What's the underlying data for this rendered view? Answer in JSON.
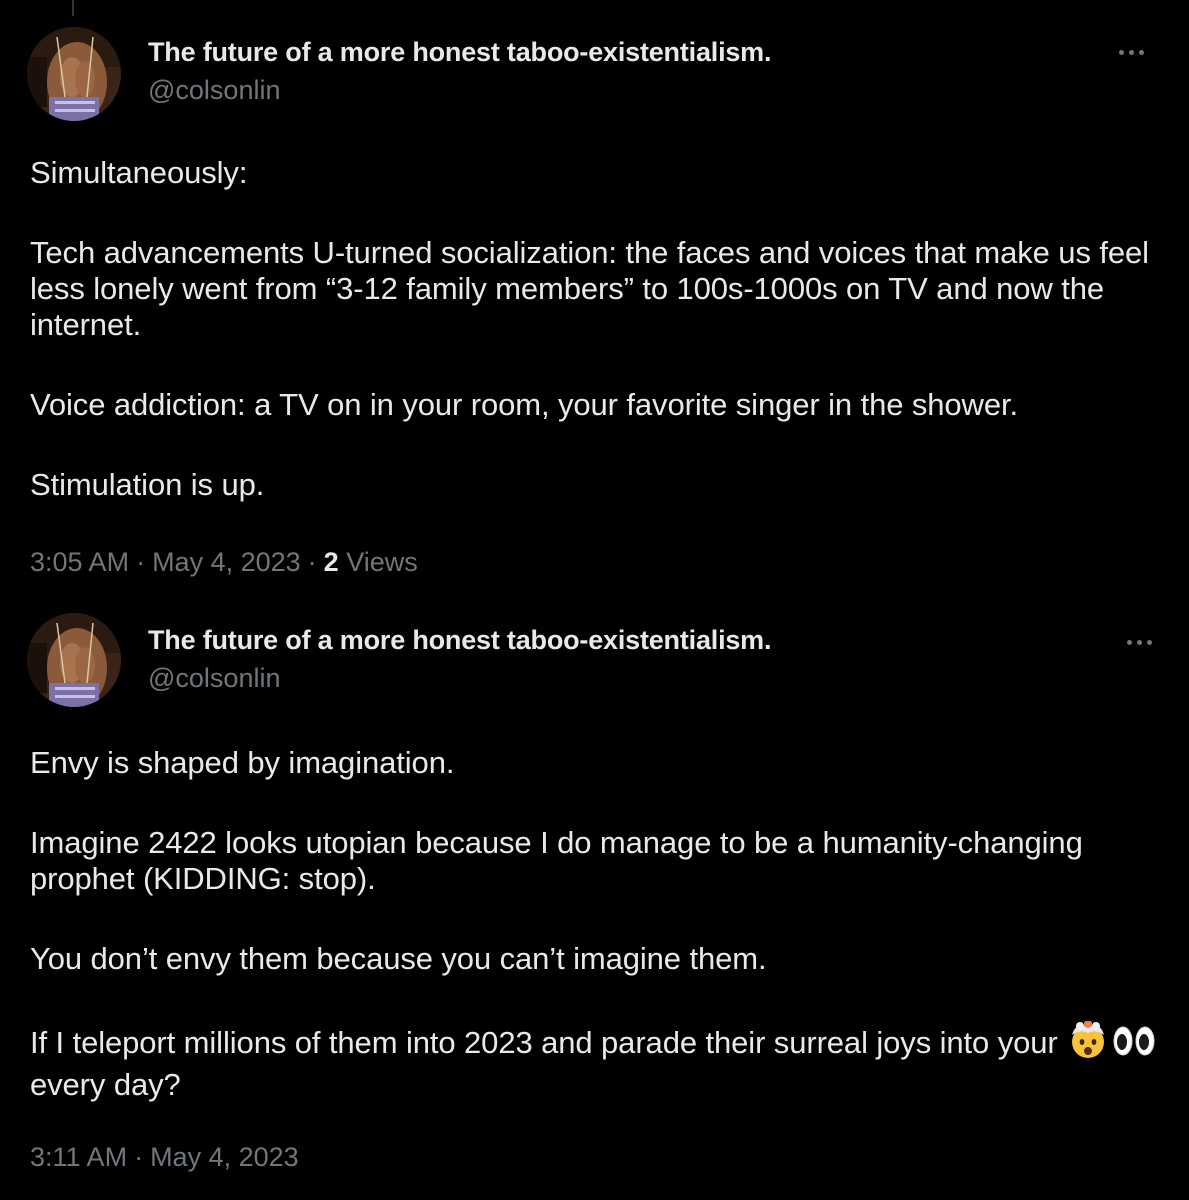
{
  "tweets": [
    {
      "display_name": "The future of a more honest taboo-existentialism.",
      "handle": "@colsonlin",
      "paragraphs": [
        "Simultaneously:",
        "Tech advancements U-turned socialization: the faces and voices that make us feel less lonely went from “3-12 family members” to 100s-1000s on TV and now the internet.",
        "Voice addiction: a TV on in your room, your favorite singer in the shower.",
        "Stimulation is up."
      ],
      "time": "3:05 AM",
      "date": "May 4, 2023",
      "views_count": "2",
      "views_label": "Views"
    },
    {
      "display_name": "The future of a more honest taboo-existentialism.",
      "handle": "@colsonlin",
      "paragraphs": [
        "Envy is shaped by imagination.",
        "Imagine 2422 looks utopian because I do manage to be a humanity-changing prophet (KIDDING: stop).",
        "You don’t envy them because you can’t imagine them."
      ],
      "last_paragraph_before_emoji": "If I teleport millions of them into 2023 and parade their surreal joys into your",
      "emojis": [
        "exploding-head-emoji",
        "eyes-emoji"
      ],
      "last_paragraph_after_emoji": "every day?",
      "time": "3:11 AM",
      "date": "May 4, 2023"
    }
  ],
  "colors": {
    "background": "#000000",
    "primary_text": "#e7e9ea",
    "secondary_text": "#71767b"
  },
  "icons": [
    "more-options-icon",
    "avatar"
  ]
}
